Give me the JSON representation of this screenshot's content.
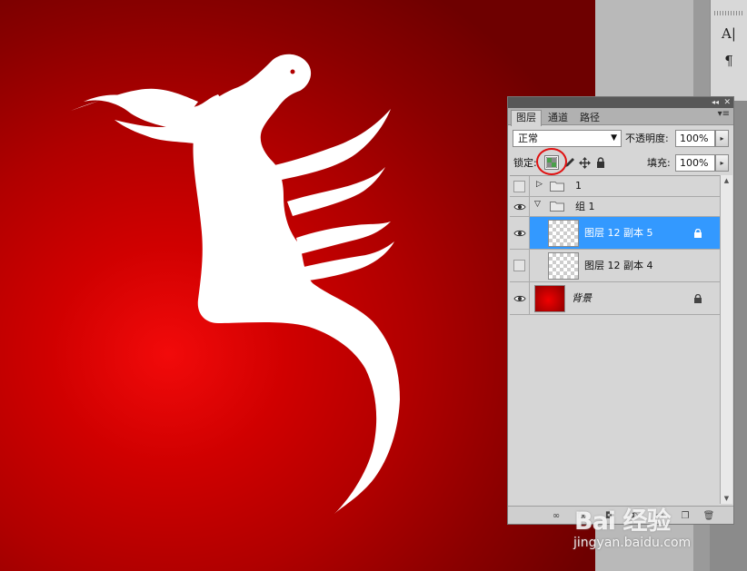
{
  "panel": {
    "tabs": [
      {
        "label": "图层",
        "active": true
      },
      {
        "label": "通道",
        "active": false
      },
      {
        "label": "路径",
        "active": false
      }
    ],
    "blend_mode": "正常",
    "opacity_label": "不透明度:",
    "opacity_value": "100%",
    "lock_label": "锁定:",
    "fill_label": "填充:",
    "fill_value": "100%"
  },
  "layers": [
    {
      "name": "1",
      "type": "group",
      "expanded": false,
      "visible": false
    },
    {
      "name": "组 1",
      "type": "group",
      "expanded": true,
      "visible": true
    },
    {
      "name": "图层 12 副本 5",
      "type": "layer",
      "visible": true,
      "selected": true,
      "locked": true
    },
    {
      "name": "图层 12 副本 4",
      "type": "layer",
      "visible": false,
      "selected": false,
      "locked": false
    },
    {
      "name": "背景",
      "type": "background",
      "visible": true,
      "selected": false,
      "locked": true
    }
  ],
  "dock": {
    "char_tool_glyph": "A|",
    "para_tool_glyph": "¶"
  },
  "watermark": {
    "brand": "Bai 经验",
    "url": "jingyan.baidu.com"
  },
  "colors": {
    "selection": "#3399ff",
    "canvas_red": "#c00000",
    "highlight_ring": "#e01010"
  }
}
